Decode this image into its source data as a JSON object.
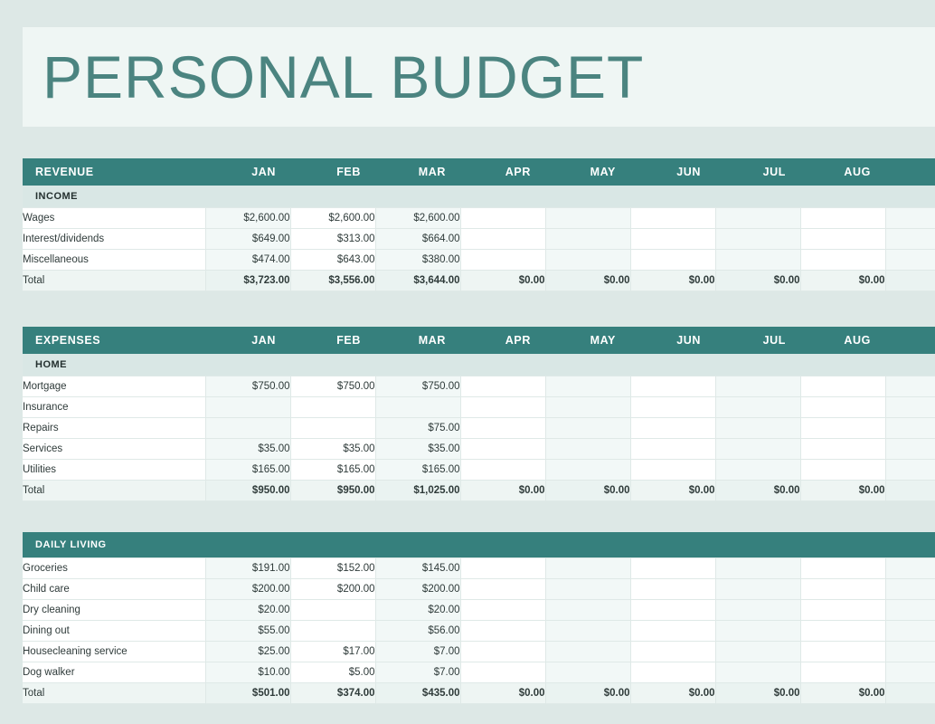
{
  "page": {
    "title": "PERSONAL BUDGET",
    "background_color": "#dde8e6",
    "banner_color": "#eff6f4",
    "accent_color": "#36807d",
    "title_color": "#4b8480"
  },
  "months": [
    "JAN",
    "FEB",
    "MAR",
    "APR",
    "MAY",
    "JUN",
    "JUL",
    "AUG"
  ],
  "blocks": [
    {
      "header": "REVENUE",
      "sections": [
        {
          "label": "INCOME",
          "label_style": "band",
          "rows": [
            {
              "label": "Wages",
              "values": [
                "$2,600.00",
                "$2,600.00",
                "$2,600.00",
                "",
                "",
                "",
                "",
                "",
                ""
              ]
            },
            {
              "label": "Interest/dividends",
              "values": [
                "$649.00",
                "$313.00",
                "$664.00",
                "",
                "",
                "",
                "",
                "",
                ""
              ]
            },
            {
              "label": "Miscellaneous",
              "values": [
                "$474.00",
                "$643.00",
                "$380.00",
                "",
                "",
                "",
                "",
                "",
                ""
              ]
            }
          ],
          "total": {
            "label": "Total",
            "values": [
              "$3,723.00",
              "$3,556.00",
              "$3,644.00",
              "$0.00",
              "$0.00",
              "$0.00",
              "$0.00",
              "$0.00",
              ""
            ]
          }
        }
      ]
    },
    {
      "header": "EXPENSES",
      "sections": [
        {
          "label": "HOME",
          "label_style": "band",
          "rows": [
            {
              "label": "Mortgage",
              "values": [
                "$750.00",
                "$750.00",
                "$750.00",
                "",
                "",
                "",
                "",
                "",
                ""
              ]
            },
            {
              "label": "Insurance",
              "values": [
                "",
                "",
                "",
                "",
                "",
                "",
                "",
                "",
                ""
              ]
            },
            {
              "label": "Repairs",
              "values": [
                "",
                "",
                "$75.00",
                "",
                "",
                "",
                "",
                "",
                ""
              ]
            },
            {
              "label": "Services",
              "values": [
                "$35.00",
                "$35.00",
                "$35.00",
                "",
                "",
                "",
                "",
                "",
                ""
              ]
            },
            {
              "label": "Utilities",
              "values": [
                "$165.00",
                "$165.00",
                "$165.00",
                "",
                "",
                "",
                "",
                "",
                ""
              ]
            }
          ],
          "total": {
            "label": "Total",
            "values": [
              "$950.00",
              "$950.00",
              "$1,025.00",
              "$0.00",
              "$0.00",
              "$0.00",
              "$0.00",
              "$0.00",
              ""
            ]
          }
        }
      ]
    },
    {
      "header": "DAILY LIVING",
      "header_style": "bar",
      "sections": [
        {
          "label": "DAILY LIVING",
          "label_style": "bar",
          "rows": [
            {
              "label": "Groceries",
              "values": [
                "$191.00",
                "$152.00",
                "$145.00",
                "",
                "",
                "",
                "",
                "",
                ""
              ]
            },
            {
              "label": "Child care",
              "values": [
                "$200.00",
                "$200.00",
                "$200.00",
                "",
                "",
                "",
                "",
                "",
                ""
              ]
            },
            {
              "label": "Dry cleaning",
              "values": [
                "$20.00",
                "",
                "$20.00",
                "",
                "",
                "",
                "",
                "",
                ""
              ]
            },
            {
              "label": "Dining out",
              "values": [
                "$55.00",
                "",
                "$56.00",
                "",
                "",
                "",
                "",
                "",
                ""
              ]
            },
            {
              "label": "Housecleaning service",
              "values": [
                "$25.00",
                "$17.00",
                "$7.00",
                "",
                "",
                "",
                "",
                "",
                ""
              ]
            },
            {
              "label": "Dog walker",
              "values": [
                "$10.00",
                "$5.00",
                "$7.00",
                "",
                "",
                "",
                "",
                "",
                ""
              ]
            }
          ],
          "total": {
            "label": "Total",
            "values": [
              "$501.00",
              "$374.00",
              "$435.00",
              "$0.00",
              "$0.00",
              "$0.00",
              "$0.00",
              "$0.00",
              ""
            ]
          }
        }
      ]
    }
  ]
}
